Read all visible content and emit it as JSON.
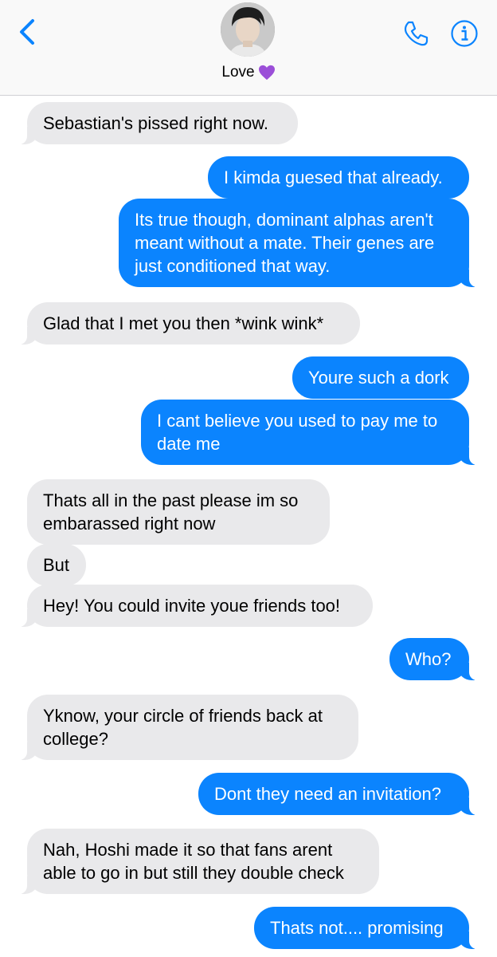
{
  "header": {
    "contact_name": "Love",
    "name_emoji": "purple-heart-icon"
  },
  "colors": {
    "accent": "#0b84fe",
    "incoming_bubble": "#e9e9eb",
    "outgoing_bubble": "#0b84fe",
    "header_bg": "#f9f9f9"
  },
  "messages": [
    {
      "from": "them",
      "text": "Sebastian's pissed right now."
    },
    {
      "from": "me",
      "text": "I kimda guesed that already."
    },
    {
      "from": "me",
      "text": "Its true though, dominant alphas aren't meant without a mate. Their genes are just conditioned that way."
    },
    {
      "from": "them",
      "text": "Glad that I met you then *wink wink*"
    },
    {
      "from": "me",
      "text": "Youre such a dork"
    },
    {
      "from": "me",
      "text": "I cant believe you used to pay me to date me"
    },
    {
      "from": "them",
      "text": "Thats all in the past please im so embarassed right now"
    },
    {
      "from": "them",
      "text": "But"
    },
    {
      "from": "them",
      "text": "Hey! You could invite youe friends too!"
    },
    {
      "from": "me",
      "text": "Who?"
    },
    {
      "from": "them",
      "text": "Yknow, your circle of friends back at college?"
    },
    {
      "from": "me",
      "text": "Dont they need an invitation?"
    },
    {
      "from": "them",
      "text": "Nah, Hoshi made it so that fans arent able to go in but still they double check"
    },
    {
      "from": "me",
      "text": "Thats not.... promising"
    }
  ]
}
